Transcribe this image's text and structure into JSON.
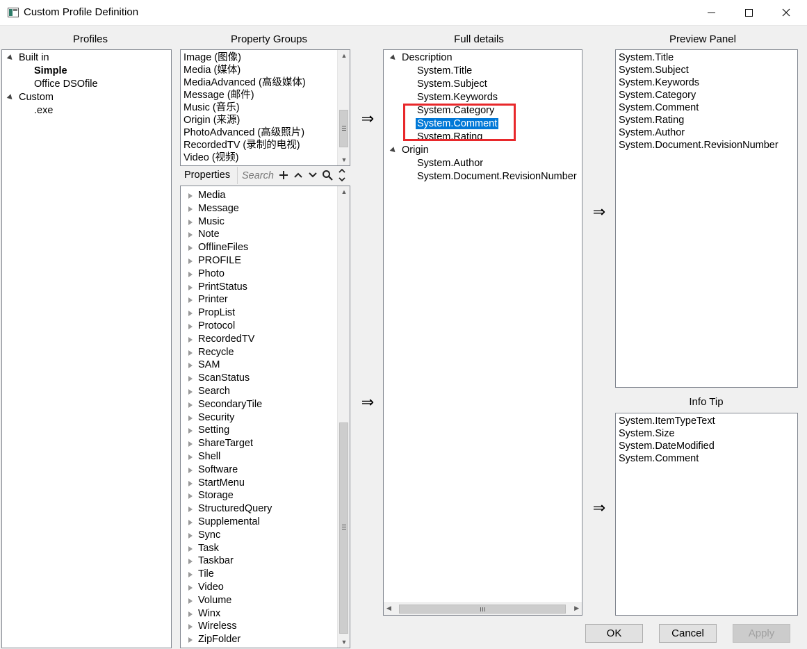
{
  "window": {
    "title": "Custom Profile Definition",
    "minimize_icon": "minimize-icon",
    "maximize_icon": "maximize-icon",
    "close_icon": "close-icon"
  },
  "headers": {
    "profiles": "Profiles",
    "property_groups": "Property Groups",
    "full_details": "Full details",
    "preview_panel": "Preview Panel",
    "info_tip": "Info Tip"
  },
  "profiles": {
    "groups": [
      {
        "label": "Built in",
        "children": [
          {
            "label": "Simple",
            "selected": true
          },
          {
            "label": "Office DSOfile"
          }
        ]
      },
      {
        "label": "Custom",
        "children": [
          {
            "label": ".exe"
          }
        ]
      }
    ]
  },
  "property_groups": [
    "Image (图像)",
    "Media (媒体)",
    "MediaAdvanced (高级媒体)",
    "Message (邮件)",
    "Music (音乐)",
    "Origin (来源)",
    "PhotoAdvanced (高级照片)",
    "RecordedTV (录制的电视)",
    "Video (视频)"
  ],
  "properties_toolbar": {
    "label": "Properties",
    "search_placeholder": "Search",
    "icons": [
      "plus-icon",
      "chevron-up-icon",
      "chevron-down-icon",
      "search-icon",
      "expand-collapse-icon"
    ]
  },
  "properties": [
    "Media",
    "Message",
    "Music",
    "Note",
    "OfflineFiles",
    "PROFILE",
    "Photo",
    "PrintStatus",
    "Printer",
    "PropList",
    "Protocol",
    "RecordedTV",
    "Recycle",
    "SAM",
    "ScanStatus",
    "Search",
    "SecondaryTile",
    "Security",
    "Setting",
    "ShareTarget",
    "Shell",
    "Software",
    "StartMenu",
    "Storage",
    "StructuredQuery",
    "Supplemental",
    "Sync",
    "Task",
    "Taskbar",
    "Tile",
    "Video",
    "Volume",
    "Winx",
    "Wireless",
    "ZipFolder"
  ],
  "full_details": {
    "groups": [
      {
        "label": "Description",
        "children": [
          "System.Title",
          "System.Subject",
          "System.Keywords",
          "System.Category",
          "System.Comment",
          "System.Rating"
        ]
      },
      {
        "label": "Origin",
        "children": [
          "System.Author",
          "System.Document.RevisionNumber"
        ]
      }
    ],
    "selected": "System.Comment"
  },
  "preview_panel": [
    "System.Title",
    "System.Subject",
    "System.Keywords",
    "System.Category",
    "System.Comment",
    "System.Rating",
    "System.Author",
    "System.Document.RevisionNumber"
  ],
  "info_tip": [
    "System.ItemTypeText",
    "System.Size",
    "System.DateModified",
    "System.Comment"
  ],
  "arrows": {
    "symbol": "⇒"
  },
  "buttons": {
    "ok": "OK",
    "cancel": "Cancel",
    "apply": "Apply"
  },
  "colors": {
    "selection": "#0078d7",
    "highlight_box": "#e8282b"
  }
}
